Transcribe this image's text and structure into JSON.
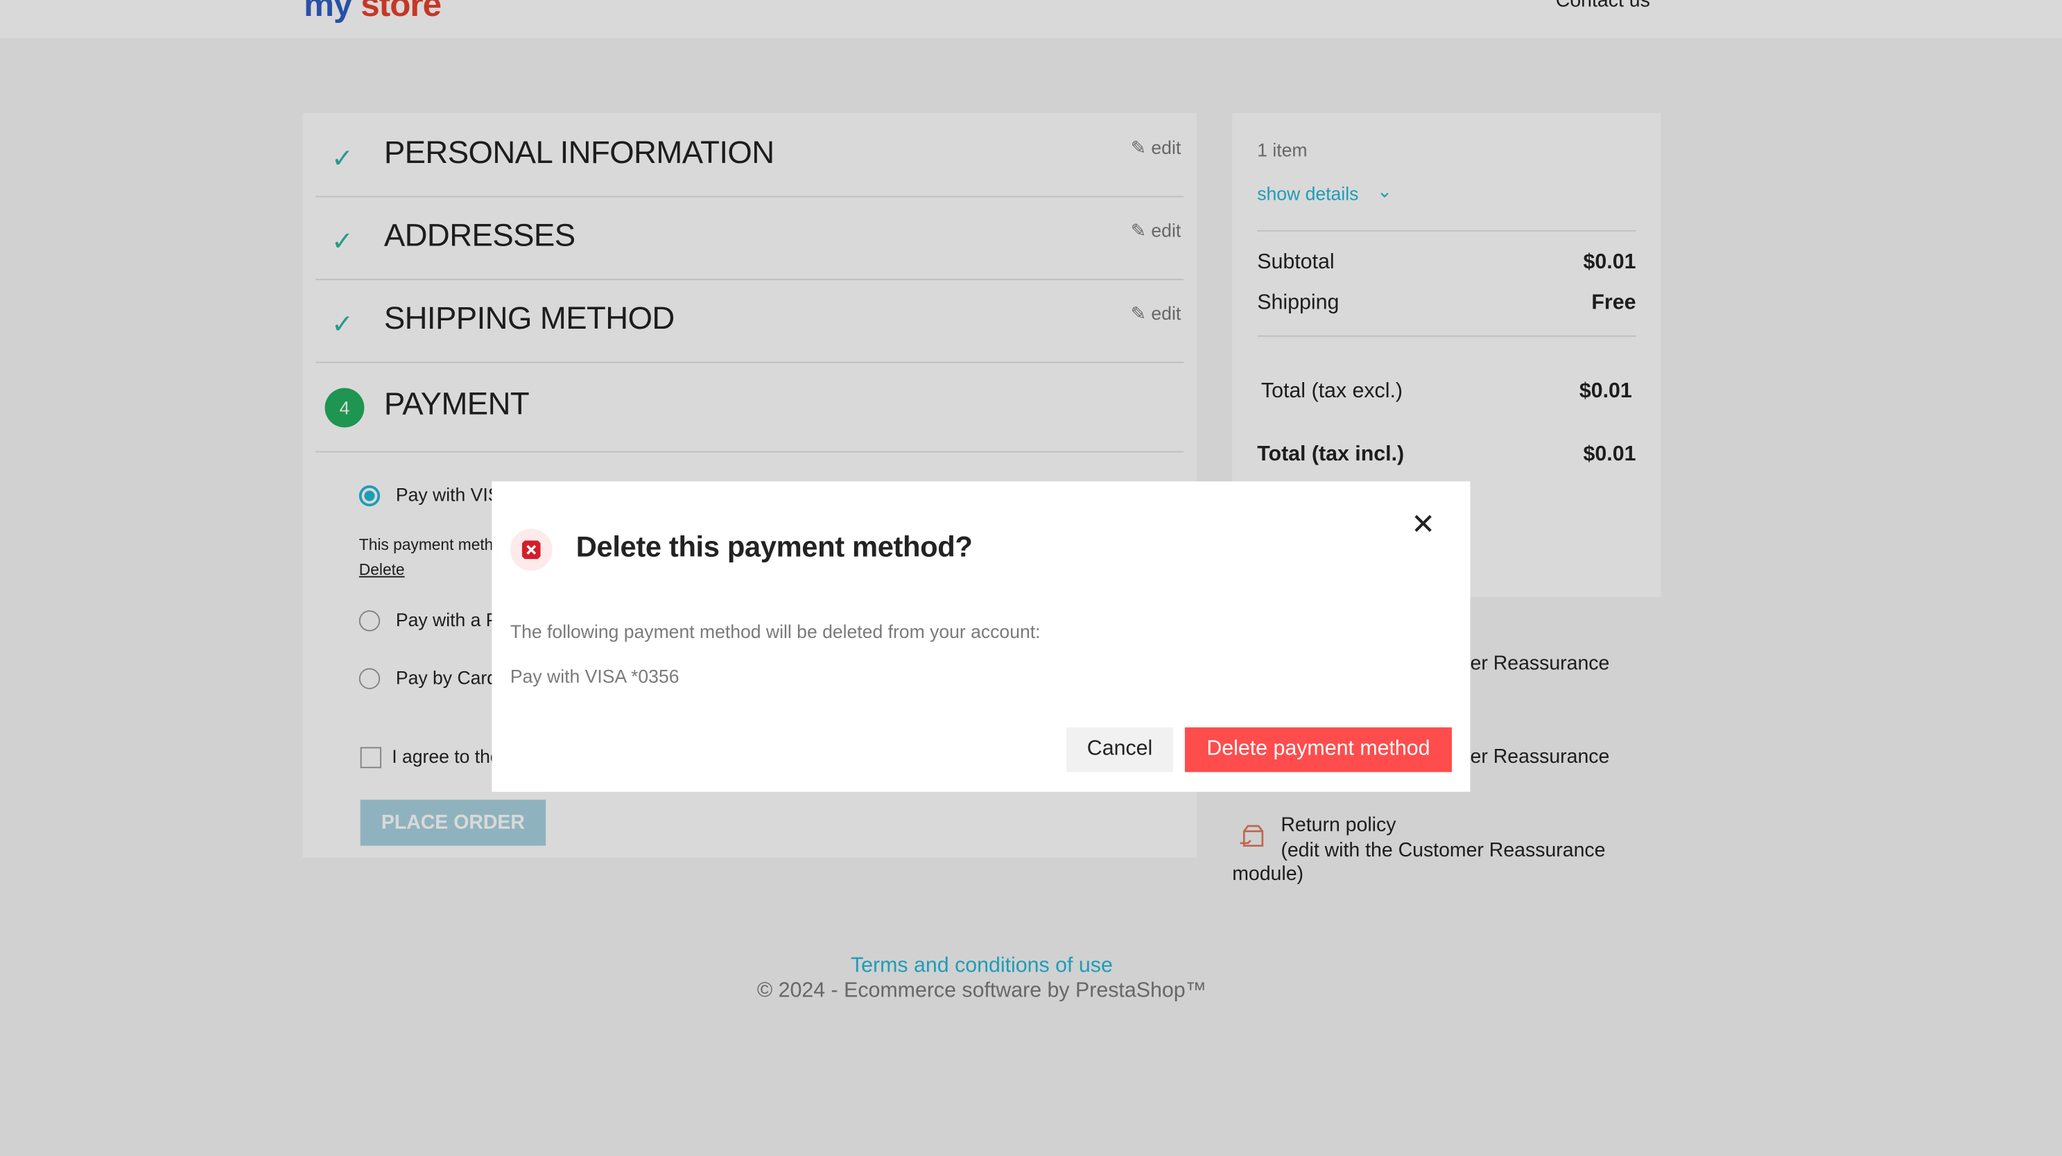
{
  "header": {
    "logo_part1": "my",
    "logo_part2": "store",
    "contact": "Contact us"
  },
  "checkout": {
    "steps": [
      {
        "title": "PERSONAL INFORMATION",
        "edit": "edit"
      },
      {
        "title": "ADDRESSES",
        "edit": "edit"
      },
      {
        "title": "SHIPPING METHOD",
        "edit": "edit"
      },
      {
        "number": "4",
        "title": "PAYMENT"
      }
    ],
    "payment_options": [
      {
        "label": "Pay with VIS"
      },
      {
        "label": "Pay with a P"
      },
      {
        "label": "Pay by Card"
      }
    ],
    "payment_note": "This payment meth",
    "delete_link": "Delete",
    "agree_text": "I agree to the",
    "place_order": "PLACE ORDER"
  },
  "summary": {
    "items_count": "1 item",
    "show_details": "show details",
    "subtotal_label": "Subtotal",
    "subtotal_value": "$0.01",
    "shipping_label": "Shipping",
    "shipping_value": "Free",
    "total_excl_label": "Total (tax excl.)",
    "total_excl_value": "$0.01",
    "total_incl_label": "Total (tax incl.)",
    "total_incl_value": "$0.01"
  },
  "reassurance": {
    "item1": "er Reassurance",
    "item2": "er Reassurance",
    "item3_title": "Return policy",
    "item3_desc": "(edit with the Customer Reassurance",
    "item3_desc2": "module)"
  },
  "modal": {
    "title": "Delete this payment method?",
    "text": "The following payment method will be deleted from your account:",
    "method": "Pay with VISA *0356",
    "cancel": "Cancel",
    "confirm": "Delete payment method"
  },
  "footer": {
    "link": "Terms and conditions of use",
    "copyright": "© 2024 - Ecommerce software by PrestaShop™"
  },
  "colors": {
    "accent": "#24b9d7",
    "danger": "#ff4c4c",
    "success": "#24b060"
  }
}
